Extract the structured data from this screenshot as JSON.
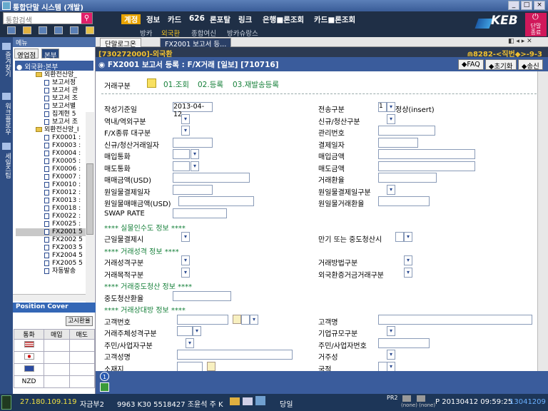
{
  "window": {
    "title": "통합단말 시스템 (개발)"
  },
  "search": {
    "placeholder": "통합검색"
  },
  "topmenu": [
    "계정",
    "정보",
    "카드",
    "626",
    "론포탈",
    "링크",
    "은행■론조회",
    "카드■론조회"
  ],
  "submenu": [
    "방카",
    "외국환",
    "종합여신",
    "방카슈랑스"
  ],
  "brand": {
    "name": "KEB",
    "side": "단말\n종료"
  },
  "sidebar": {
    "labels": [
      "즐겨찾기",
      "워크플로우",
      "세일즈팁"
    ]
  },
  "leftpanel": {
    "title": "메뉴",
    "tabs": [
      "영업점",
      "본부"
    ],
    "root": "외국환:본부",
    "tree": [
      {
        "type": "folder",
        "label": "외환전산망_"
      },
      {
        "type": "doc",
        "label": "보고서정"
      },
      {
        "type": "doc",
        "label": "보고서 관"
      },
      {
        "type": "doc",
        "label": "보고서 조"
      },
      {
        "type": "doc",
        "label": "보고서별"
      },
      {
        "type": "doc",
        "label": "집계현 5"
      },
      {
        "type": "doc",
        "label": "보고서 조"
      },
      {
        "type": "folder",
        "label": "외환전산망_I"
      },
      {
        "type": "doc",
        "label": "FX0001 :"
      },
      {
        "type": "doc",
        "label": "FX0003 :"
      },
      {
        "type": "doc",
        "label": "FX0004 :"
      },
      {
        "type": "doc",
        "label": "FX0005 :"
      },
      {
        "type": "doc",
        "label": "FX0006 :"
      },
      {
        "type": "doc",
        "label": "FX0007 :"
      },
      {
        "type": "doc",
        "label": "FX0010 :"
      },
      {
        "type": "doc",
        "label": "FX0012 :"
      },
      {
        "type": "doc",
        "label": "FX0013 :"
      },
      {
        "type": "doc",
        "label": "FX0018 :"
      },
      {
        "type": "doc",
        "label": "FX0022 :"
      },
      {
        "type": "doc",
        "label": "FX0025 :"
      },
      {
        "type": "doc",
        "label": "FX2001 5",
        "selected": true
      },
      {
        "type": "doc",
        "label": "FX2002 5"
      },
      {
        "type": "doc",
        "label": "FX2003 5"
      },
      {
        "type": "doc",
        "label": "FX2004 5"
      },
      {
        "type": "doc",
        "label": "FX2005 5"
      },
      {
        "type": "doc",
        "label": "자동발송"
      }
    ]
  },
  "position": {
    "title": "Position Cover",
    "button": "고시환율",
    "headers": [
      "통화",
      "매입",
      "매도"
    ],
    "rows": [
      {
        "flag": "US"
      },
      {
        "flag": "JP"
      },
      {
        "flag": "EU"
      },
      {
        "flag": "NZD"
      }
    ]
  },
  "tabs": [
    "단말로그온",
    "FX2001 보고서 등..."
  ],
  "codebar": "[730272000]-외국환",
  "codebar_right": "⋒8282-<직번◆>-9-3",
  "form": {
    "title": "FX2001 보고서 등록 : F/X거래 [일보] [710716]",
    "buttons": [
      "FAQ",
      "초기화",
      "송신"
    ],
    "kind_label": "거래구분",
    "kind_options": [
      "01.조회",
      "02.등록",
      "03.재발송등록"
    ],
    "fields": {
      "date_label": "작성기준일",
      "date_value": "2013-04-12",
      "send_label": "전송구분",
      "send_num": "1",
      "send_text": "정상(insert)",
      "l1": "역내/역외구분",
      "r1": "신규/청산구분",
      "l2": "F/X종류 대구분",
      "r2": "관리번호",
      "l3": "신규/청산거래일자",
      "r3": "결제일자",
      "l4": "매입통화",
      "r4": "매입금액",
      "l5": "매도통화",
      "r5": "매도금액",
      "l6": "매매금액(USD)",
      "r6": "거래환율",
      "l7": "원일물결제일자",
      "r7": "원일물결제일구분",
      "l8": "원일물매매금액(USD)",
      "r8": "원일물거래환율",
      "l9": "SWAP RATE",
      "sect1": "**** 실물인수도 정보 ****",
      "l10": "근일물결제시",
      "r10": "만기 또는 중도청산시",
      "sect2": "**** 거래성격 정보 ****",
      "l11": "거래성격구분",
      "r11": "거래방법구분",
      "l12": "거래목적구분",
      "r12": "외국환증거금거래구분",
      "sect3": "**** 거래중도청산 정보 ****",
      "l13": "중도청산환율",
      "sect4": "**** 거래상대방 정보 ****",
      "l14": "고객번호",
      "r14": "고객명",
      "l15": "거래주체성격구분",
      "r15": "기업규모구분",
      "l16": "주민/사업자구분",
      "r16": "주민/사업자번호",
      "l17": "고객성명",
      "r17": "거주성",
      "l18": "소재지",
      "r18": "국적"
    }
  },
  "status": {
    "ip": "27.180.109.119",
    "name": "자금부2",
    "user": "9963 K30 5518427 조윤석 주 K",
    "day": "당일",
    "pr": "PR2",
    "none": "(none) (none)",
    "time": "P 20130412 09:59:25",
    "code": "13041209"
  }
}
